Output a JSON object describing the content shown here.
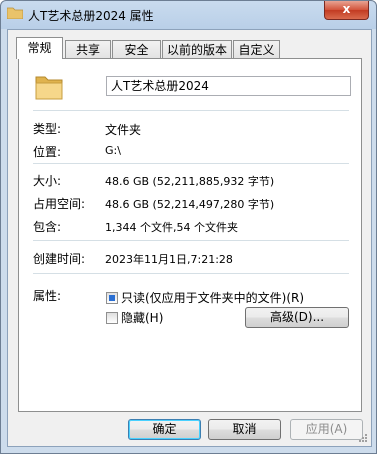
{
  "window": {
    "title": "人T艺术总册2024 属性",
    "close_symbol": "x"
  },
  "tabs": [
    {
      "label": "常规"
    },
    {
      "label": "共享"
    },
    {
      "label": "安全"
    },
    {
      "label": "以前的版本"
    },
    {
      "label": "自定义"
    }
  ],
  "general": {
    "name": "人T艺术总册2024",
    "rows": [
      {
        "label": "类型:",
        "value": "文件夹"
      },
      {
        "label": "位置:",
        "value": "G:\\"
      },
      {
        "label": "大小:",
        "value": "48.6 GB (52,211,885,932 字节)"
      },
      {
        "label": "占用空间:",
        "value": "48.6 GB (52,214,497,280 字节)"
      },
      {
        "label": "包含:",
        "value": "1,344 个文件,54 个文件夹"
      },
      {
        "label": "创建时间:",
        "value": "2023年11月1日,7:21:28"
      }
    ],
    "attributes_label": "属性:",
    "readonly_label": "只读(仅应用于文件夹中的文件)(R)",
    "hidden_label": "隐藏(H)",
    "advanced_label": "高级(D)..."
  },
  "buttons": {
    "ok": "确定",
    "cancel": "取消",
    "apply": "应用(A)"
  },
  "colors": {
    "accent": "#2a6fd3",
    "close": "#c23b22"
  }
}
